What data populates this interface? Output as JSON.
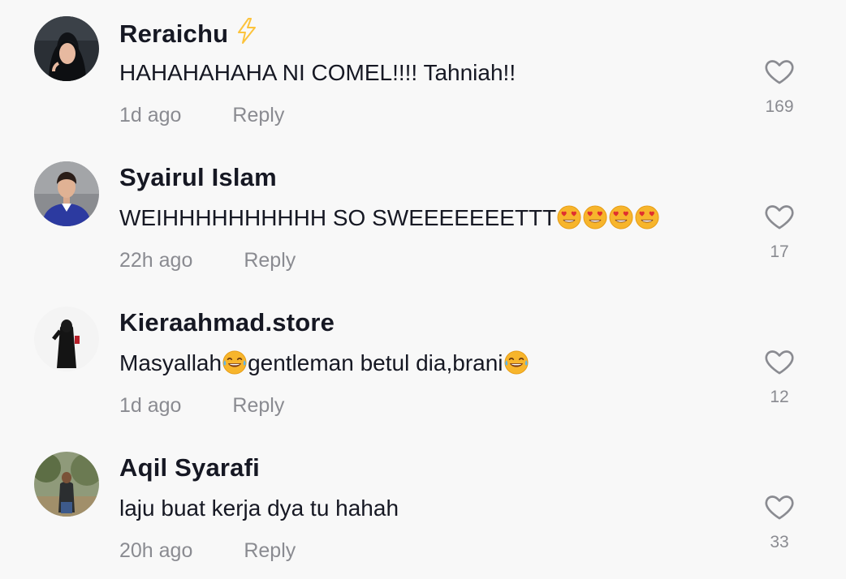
{
  "comments": [
    {
      "username": "Reraichu",
      "text_parts": [
        "HAHAHAHAHA NI COMEL!!!! Tahniah!!"
      ],
      "time": "1d ago",
      "reply": "Reply",
      "likes": "169",
      "badge_icon": "lightning-icon",
      "avatar_icon": "avatar-hijab-woman"
    },
    {
      "username": "Syairul Islam",
      "text_parts": [
        "WEIHHHHHHHHHH SO SWEEEEEEETTT"
      ],
      "emojis": [
        "heart-eyes-emoji",
        "heart-eyes-emoji",
        "heart-eyes-emoji",
        "heart-eyes-emoji"
      ],
      "time": "22h ago",
      "reply": "Reply",
      "likes": "17",
      "avatar_icon": "avatar-man-blue-sweater"
    },
    {
      "username": "Kieraahmad.store",
      "text_parts": [
        "Masyallah",
        "gentleman betul dia,brani"
      ],
      "emojis": [
        "tears-of-joy-emoji",
        "tears-of-joy-emoji"
      ],
      "time": "1d ago",
      "reply": "Reply",
      "likes": "12",
      "avatar_icon": "avatar-black-dress"
    },
    {
      "username": "Aqil Syarafi",
      "text_parts": [
        "laju buat kerja dya tu hahah"
      ],
      "time": "20h ago",
      "reply": "Reply",
      "likes": "33",
      "avatar_icon": "avatar-man-outdoors"
    }
  ],
  "colors": {
    "background": "#f8f8f8",
    "primary_text": "#161823",
    "secondary_text": "#8a8b91",
    "badge": "#fcc33c"
  }
}
